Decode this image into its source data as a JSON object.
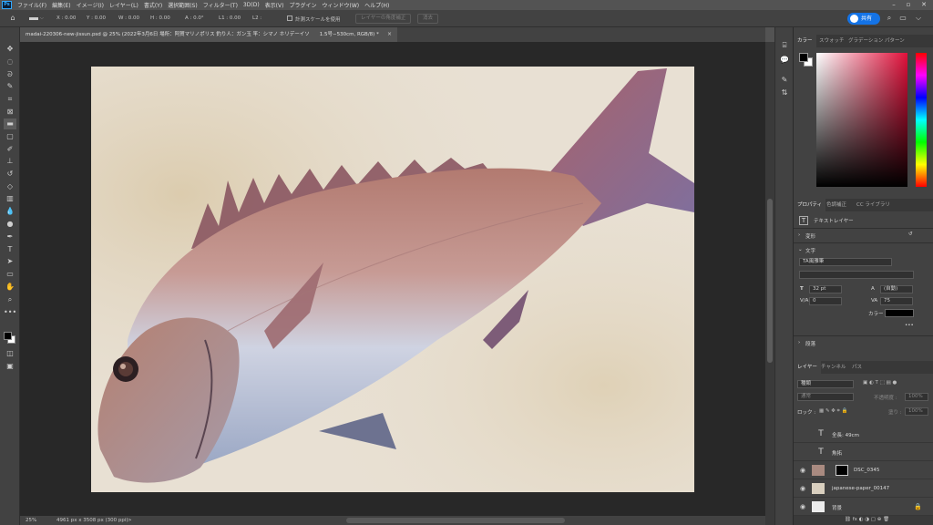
{
  "menu": {
    "items": [
      "ファイル(F)",
      "編集(E)",
      "イメージ(I)",
      "レイヤー(L)",
      "書式(Y)",
      "選択範囲(S)",
      "フィルター(T)",
      "3D(D)",
      "表示(V)",
      "プラグイン",
      "ウィンドウ(W)",
      "ヘルプ(H)"
    ],
    "logo": "Ps"
  },
  "options": {
    "x": "X : 0.00",
    "y": "Y : 0.00",
    "w": "W : 0.00",
    "h": "H : 0.00",
    "a": "A : 0.0°",
    "l1": "L1 : 0.00",
    "l2": "L2 :",
    "scale_checkbox": "計測スケールを使用",
    "angle_button": "レイヤーの角度補正",
    "clear_button": "消去",
    "share": "共有"
  },
  "tab": {
    "title": "madai-220306-new-jissun.psd @ 25% (2022年3月6日 場所：阿賀マリノポリス 釣り人：ガン玉 竿：シマノ ホリデーイソ　　1.5号−530cm, RGB/8) *",
    "close": "×"
  },
  "status": {
    "zoom": "25%",
    "doc_size": "4961 px x 3508 px (300 ppi)",
    "arrow": ">"
  },
  "color_panel": {
    "tabs": [
      "カラー",
      "スウォッチ",
      "グラデーション",
      "パターン"
    ]
  },
  "properties": {
    "tabs": [
      "プロパティ",
      "色調補正",
      "CC ライブラリ"
    ],
    "layer_type": "テキストレイヤー",
    "transform": "変形",
    "text_section": "文字",
    "font": "TA風雅筆",
    "font_size": "32 pt",
    "leading": "(自動)",
    "tracking": "0",
    "scale": "75",
    "color_label": "カラー",
    "more": "•••",
    "paragraph": "段落"
  },
  "layers_panel": {
    "tabs": [
      "レイヤー",
      "チャンネル",
      "パス"
    ],
    "filter": "種類",
    "blend_mode": "通常",
    "opacity_label": "不透明度 :",
    "opacity_value": "100%",
    "lock_label": "ロック :",
    "fill_label": "塗り :",
    "fill_value": "100%",
    "layers": [
      {
        "name": "全長: 49cm",
        "type": "text"
      },
      {
        "name": "魚拓",
        "type": "text"
      },
      {
        "name": "DSC_0345",
        "type": "image"
      },
      {
        "name": "japanese-paper_00147",
        "type": "image"
      },
      {
        "name": "背景",
        "type": "background"
      }
    ]
  },
  "colors": {
    "accent": "#1473e6",
    "foreground": "#000000",
    "background": "#ffffff",
    "text_color_swatch": "#000000"
  }
}
